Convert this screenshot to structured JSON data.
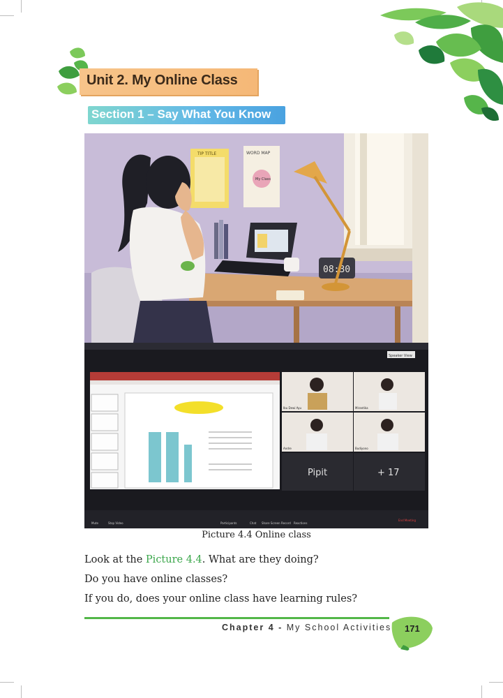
{
  "unit_title": "Unit 2. My Online Class",
  "section_title": "Section 1 – Say What You Know",
  "illustration": {
    "classroom_poster": "TIP TITLE",
    "mind_map_poster": "WORD MAP",
    "mind_map_center": "My Class",
    "clock_display": "08:30",
    "video_call": {
      "tiles": [
        "Ibu Dewi Ayu",
        "Mirantika",
        "Andre",
        "Budiyono"
      ],
      "name_tile": "Pipit",
      "more_count": "+ 17",
      "toolbar": [
        "Mute",
        "Stop Video",
        "Participants",
        "Chat",
        "Share Screen",
        "Record",
        "Reactions"
      ],
      "end_label": "End Meeting",
      "view_label": "Speaker View"
    }
  },
  "caption": "Picture 4.4 Online class",
  "body": {
    "line1_pre": "Look at the ",
    "line1_ref": "Picture 4.4",
    "line1_post": ". What are they doing?",
    "line2": "Do you have online classes?",
    "line3": "If you do, does your online class have learning rules?"
  },
  "footer": {
    "chapter_label": "Chapter 4 - ",
    "chapter_title": "My School Activities",
    "page_number": "171"
  }
}
